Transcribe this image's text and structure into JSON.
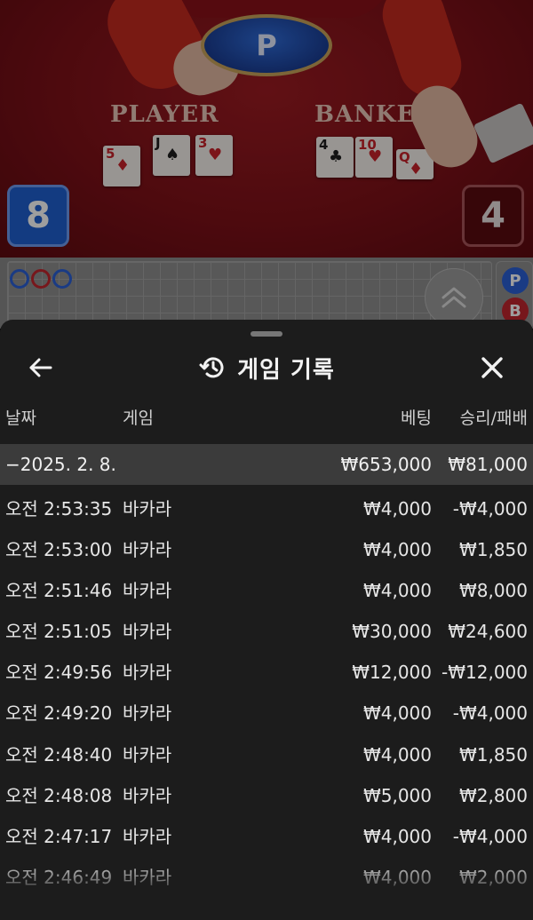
{
  "game_view": {
    "dealer_badge": "P",
    "player_label": "PLAYER",
    "banker_label": "BANKE",
    "player_score": "8",
    "banker_score": "4",
    "player_cards": [
      {
        "rank": "5",
        "suit": "♦",
        "color": "red"
      },
      {
        "rank": "J",
        "suit": "♠",
        "color": "black"
      },
      {
        "rank": "3",
        "suit": "♥",
        "color": "red"
      }
    ],
    "banker_cards": [
      {
        "rank": "4",
        "suit": "♣",
        "color": "black"
      },
      {
        "rank": "10",
        "suit": "♥",
        "color": "red"
      },
      {
        "rank": "Q",
        "suit": "♦",
        "color": "red"
      }
    ],
    "road_side": {
      "player": "P",
      "banker": "B"
    }
  },
  "history": {
    "title": "게임 기록",
    "columns": {
      "date": "날짜",
      "game": "게임",
      "bet": "베팅",
      "win_loss": "승리/패배"
    },
    "summary": {
      "date": "−2025. 2. 8.",
      "bet": "₩653,000",
      "win_loss": "₩81,000"
    },
    "rows": [
      {
        "time": "오전 2:53:35",
        "game": "바카라",
        "bet": "₩4,000",
        "result": "-₩4,000"
      },
      {
        "time": "오전 2:53:00",
        "game": "바카라",
        "bet": "₩4,000",
        "result": "₩1,850"
      },
      {
        "time": "오전 2:51:46",
        "game": "바카라",
        "bet": "₩4,000",
        "result": "₩8,000"
      },
      {
        "time": "오전 2:51:05",
        "game": "바카라",
        "bet": "₩30,000",
        "result": "₩24,600"
      },
      {
        "time": "오전 2:49:56",
        "game": "바카라",
        "bet": "₩12,000",
        "result": "-₩12,000"
      },
      {
        "time": "오전 2:49:20",
        "game": "바카라",
        "bet": "₩4,000",
        "result": "-₩4,000"
      },
      {
        "time": "오전 2:48:40",
        "game": "바카라",
        "bet": "₩4,000",
        "result": "₩1,850"
      },
      {
        "time": "오전 2:48:08",
        "game": "바카라",
        "bet": "₩5,000",
        "result": "₩2,800"
      },
      {
        "time": "오전 2:47:17",
        "game": "바카라",
        "bet": "₩4,000",
        "result": "-₩4,000"
      },
      {
        "time": "오전 2:46:49",
        "game": "바카라",
        "bet": "₩4,000",
        "result": "₩2,000"
      }
    ]
  },
  "colors": {
    "sheet_bg": "#1c1c1c",
    "summary_bg": "#3b3b3b",
    "player_blue": "#1f5fd0",
    "banker_red": "#c0262e",
    "felt_red": "#7e1118"
  },
  "icons": {
    "back": "arrow-left-icon",
    "history": "history-clock-icon",
    "close": "close-icon",
    "collapse": "chevron-double-up-icon"
  }
}
